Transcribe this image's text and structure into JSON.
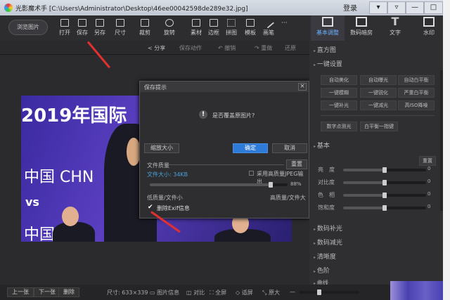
{
  "window": {
    "title": "光影魔术手 [C:\\Users\\Administrator\\Desktop\\46ee00042598de289e32.jpg]",
    "login": "登录",
    "controls": [
      "▾",
      "▿",
      "—",
      "□",
      "✕"
    ]
  },
  "toolbar": {
    "back": "浏览图片",
    "tools": [
      "打开",
      "保存",
      "另存",
      "尺寸",
      "裁剪",
      "旋转",
      "素材",
      "边框",
      "拼图",
      "模板",
      "画笔"
    ],
    "more": "···"
  },
  "subbar": {
    "share": "分享",
    "save_action": "保存动作",
    "undo": "撤销",
    "redo": "重做",
    "restore": "还原"
  },
  "photo": {
    "line1": "2019年国际",
    "line2": "中国 CHN",
    "line3": "vs",
    "line4": "中国香港"
  },
  "dialog": {
    "title": "保存提示",
    "question": "是否覆盖原图片?",
    "resize": "缩放大小",
    "ok": "确定",
    "cancel": "取消",
    "quality_label": "文件质量",
    "reset": "重置",
    "file_size": "文件大小: 34KB",
    "high_quality_jpeg": "采用高质量JPEG输出",
    "quality_value": "88%",
    "quality_pct": 88,
    "low": "低质量/文件小",
    "high": "高质量/文件大",
    "exif": "删除Exif信息",
    "exif_checked": true
  },
  "panel": {
    "tabs": [
      "基本调整",
      "数码暗房",
      "文字",
      "水印"
    ],
    "histogram": "直方图",
    "oneclick": "一键设置",
    "buttons": [
      "自动美化",
      "自动曝光",
      "自动白平衡",
      "一键模糊",
      "一键锐化",
      "严重白平衡",
      "一键补光",
      "一键减光",
      "高ISO降噪",
      "数字点测光",
      "白平衡一指键"
    ],
    "basic": "基本",
    "reset": "重置",
    "sliders": [
      {
        "label": "亮　度",
        "value": "0"
      },
      {
        "label": "对比度",
        "value": "0"
      },
      {
        "label": "色　相",
        "value": "0"
      },
      {
        "label": "饱和度",
        "value": "0"
      }
    ],
    "sections": [
      "数码补光",
      "数码减光",
      "清晰度",
      "色阶",
      "曲线"
    ]
  },
  "bottom": {
    "prev": "上一张",
    "next": "下一张",
    "delete": "删除",
    "size": "尺寸: 633×339",
    "info": "图片信息",
    "compare": "对比",
    "fullscreen": "全屏",
    "fit": "适屏",
    "zoom_in": "原大",
    "zoom_out": "—"
  }
}
